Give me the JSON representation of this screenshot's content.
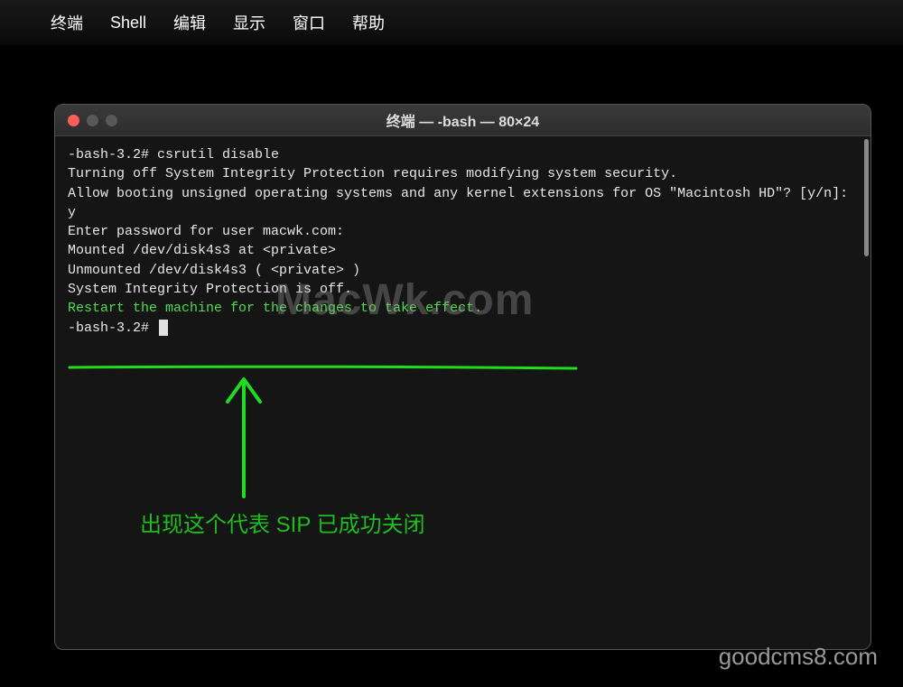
{
  "menubar": {
    "apple": "",
    "items": [
      "终端",
      "Shell",
      "编辑",
      "显示",
      "窗口",
      "帮助"
    ]
  },
  "window": {
    "title": "终端 — -bash — 80×24"
  },
  "terminal": {
    "lines": [
      "-bash-3.2# csrutil disable",
      "Turning off System Integrity Protection requires modifying system security.",
      "Allow booting unsigned operating systems and any kernel extensions for OS \"Macintosh HD\"? [y/n]: y",
      "",
      "Enter password for user macwk.com:",
      "Mounted /dev/disk4s3 at <private>",
      "Unmounted /dev/disk4s3 ( <private> )",
      "System Integrity Protection is off."
    ],
    "green_line": "Restart the machine for the changes to take effect.",
    "prompt": "-bash-3.2# "
  },
  "watermark": "MacWk.com",
  "annotation": {
    "text": "出现这个代表 SIP 已成功关闭"
  },
  "footer": "goodcms8.com"
}
